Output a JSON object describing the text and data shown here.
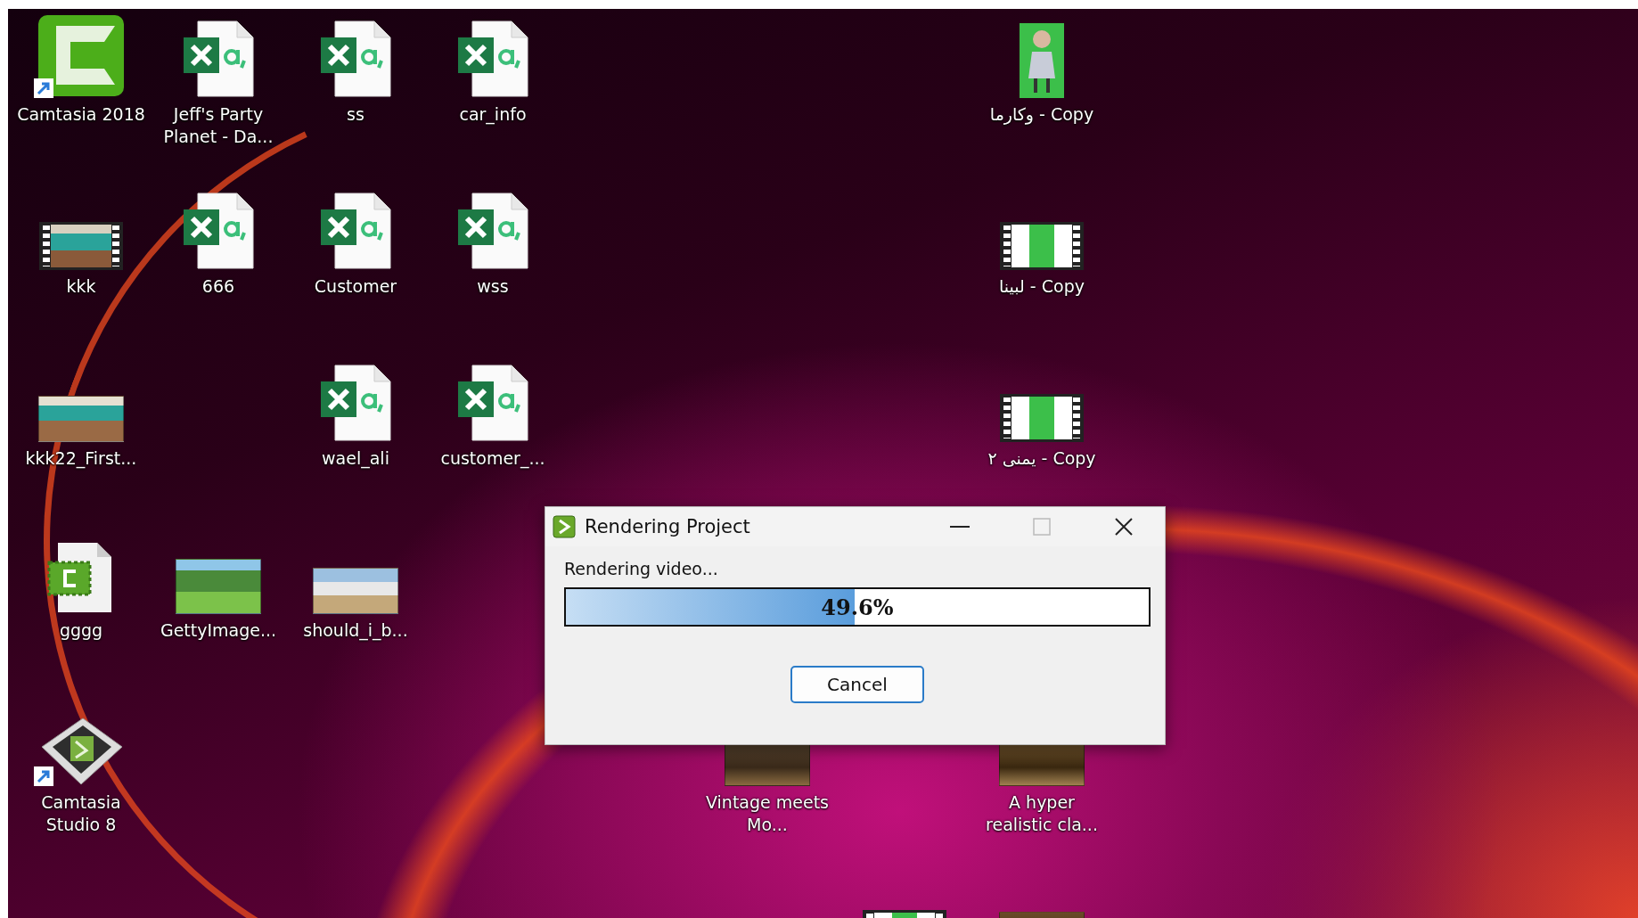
{
  "desktop": {
    "icons": [
      {
        "label": "Camtasia 2018",
        "kind": "camtasia-app",
        "shortcut": true
      },
      {
        "label": "Jeff's Party Planet - Da...",
        "kind": "spreadsheet",
        "shortcut": false
      },
      {
        "label": "ss",
        "kind": "spreadsheet",
        "shortcut": false
      },
      {
        "label": "car_info",
        "kind": "spreadsheet",
        "shortcut": false
      },
      {
        "label": "وكارما - Copy",
        "kind": "portrait",
        "shortcut": false
      },
      {
        "label": "kkk",
        "kind": "video",
        "shortcut": false
      },
      {
        "label": "666",
        "kind": "spreadsheet",
        "shortcut": false
      },
      {
        "label": "Customer",
        "kind": "spreadsheet",
        "shortcut": false
      },
      {
        "label": "wss",
        "kind": "spreadsheet",
        "shortcut": false
      },
      {
        "label": "لبينا - Copy",
        "kind": "video",
        "shortcut": false
      },
      {
        "label": "kkk22_First...",
        "kind": "photo",
        "shortcut": false
      },
      {
        "label": "wael_ali",
        "kind": "spreadsheet",
        "shortcut": false
      },
      {
        "label": "customer_...",
        "kind": "spreadsheet",
        "shortcut": false
      },
      {
        "label": "يمنى ٢ - Copy",
        "kind": "video",
        "shortcut": false
      },
      {
        "label": "gggg",
        "kind": "camtasia-project",
        "shortcut": false
      },
      {
        "label": "GettyImage...",
        "kind": "photo",
        "shortcut": false
      },
      {
        "label": "should_i_b...",
        "kind": "photo",
        "shortcut": false
      },
      {
        "label": "Camtasia Studio 8",
        "kind": "camtasia-studio",
        "shortcut": true
      },
      {
        "label": "Vintage meets Mo...",
        "kind": "photo",
        "shortcut": false
      },
      {
        "label": "A hyper realistic cla...",
        "kind": "photo",
        "shortcut": false
      },
      {
        "kind": "video",
        "shortcut": false
      },
      {
        "kind": "photo",
        "shortcut": false
      }
    ]
  },
  "dialog": {
    "title": "Rendering Project",
    "status": "Rendering video...",
    "progress": {
      "level": 0.496,
      "reading": "49.6%"
    },
    "buttons": [
      "Cancel"
    ]
  }
}
